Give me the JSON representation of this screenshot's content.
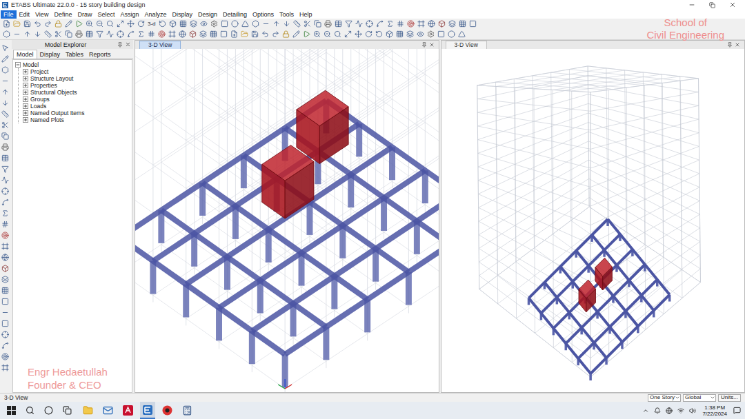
{
  "window": {
    "title": "ETABS Ultimate 22.0.0 - 15 story building design"
  },
  "watermarks": {
    "top_right": [
      "School of",
      "Civil Engineering"
    ],
    "bottom_left": [
      "Engr Hedaetullah",
      "Founder & CEO"
    ]
  },
  "menu": [
    {
      "label": "File",
      "selected": true
    },
    {
      "label": "Edit",
      "selected": false
    },
    {
      "label": "View",
      "selected": false
    },
    {
      "label": "Define",
      "selected": false
    },
    {
      "label": "Draw",
      "selected": false
    },
    {
      "label": "Select",
      "selected": false
    },
    {
      "label": "Assign",
      "selected": false
    },
    {
      "label": "Analyze",
      "selected": false
    },
    {
      "label": "Display",
      "selected": false
    },
    {
      "label": "Design",
      "selected": false
    },
    {
      "label": "Detailing",
      "selected": false
    },
    {
      "label": "Options",
      "selected": false
    },
    {
      "label": "Tools",
      "selected": false
    },
    {
      "label": "Help",
      "selected": false
    }
  ],
  "toolbar": {
    "labels": [
      "3-d"
    ]
  },
  "model_explorer": {
    "title": "Model Explorer",
    "tabs": [
      {
        "label": "Model",
        "selected": true
      },
      {
        "label": "Display",
        "selected": false
      },
      {
        "label": "Tables",
        "selected": false
      },
      {
        "label": "Reports",
        "selected": false
      }
    ],
    "tree": {
      "label": "Model",
      "expanded": true,
      "children": [
        {
          "label": "Project",
          "expanded": false
        },
        {
          "label": "Structure Layout",
          "expanded": false
        },
        {
          "label": "Properties",
          "expanded": false
        },
        {
          "label": "Structural Objects",
          "expanded": false
        },
        {
          "label": "Groups",
          "expanded": false
        },
        {
          "label": "Loads",
          "expanded": false
        },
        {
          "label": "Named Output Items",
          "expanded": false
        },
        {
          "label": "Named Plots",
          "expanded": false
        }
      ]
    }
  },
  "views": [
    {
      "title": "3-D View",
      "selected": true
    },
    {
      "title": "3-D View",
      "selected": false
    }
  ],
  "status_bar": {
    "text": "3-D View",
    "story": "One Story",
    "system": "Global",
    "units": "Units..."
  },
  "taskbar": {
    "time": "1:38 PM",
    "date": "7/22/2024"
  }
}
